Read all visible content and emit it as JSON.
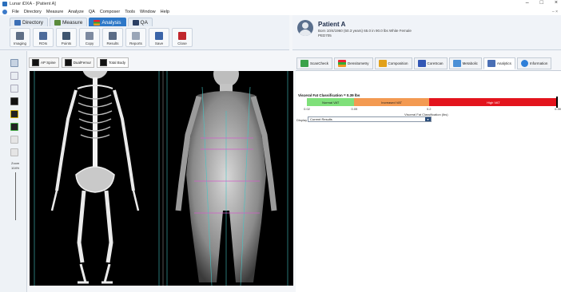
{
  "window": {
    "title": "Lunar iDXA - [Patient A]",
    "minimize": "–",
    "maximize": "□",
    "close": "×"
  },
  "menu": [
    "File",
    "Directory",
    "Measure",
    "Analyze",
    "QA",
    "Composer",
    "Tools",
    "Window",
    "Help"
  ],
  "menu_mdi": "– ×",
  "ribbon": {
    "tabs": [
      {
        "label": "Directory",
        "active": false
      },
      {
        "label": "Measure",
        "active": false
      },
      {
        "label": "Analysis",
        "active": true
      },
      {
        "label": "QA",
        "active": false
      }
    ],
    "buttons": [
      "Imaging",
      "ROIs",
      "Points",
      "Copy",
      "Results",
      "Reports",
      "Save",
      "Close"
    ]
  },
  "patient": {
    "name": "Patient A",
    "details": "Born 10/4/1960 (50.3 years)   65.0 in  90.0 lbs    White Female",
    "id": "PED705"
  },
  "zoom": {
    "label": "Zoom",
    "value": "104%"
  },
  "view_tabs": [
    "AP Spine",
    "DualFemur",
    "Total Body"
  ],
  "analysis_tabs": [
    {
      "label": "ScanCheck",
      "color": "#3aa24a",
      "active": false
    },
    {
      "label": "Densitometry",
      "color": "#e2a11a",
      "active": false
    },
    {
      "label": "Composition",
      "color": "#e2a11a",
      "active": false
    },
    {
      "label": "CoreScan",
      "color": "#3357b5",
      "active": false
    },
    {
      "label": "Metabolic",
      "color": "#4a8fd6",
      "active": false
    },
    {
      "label": "Analytics",
      "color": "#4a6fb5",
      "active": true
    },
    {
      "label": "Information",
      "color": "#2f7fd8",
      "active": false
    }
  ],
  "visceral_fat": {
    "title": "Visceral Fat Classification = 0.39 lbs",
    "value": 0.39,
    "segments": [
      {
        "label": "Normal VAT",
        "color": "#7fe07a",
        "from": 0.02,
        "to": 0.09
      },
      {
        "label": "Increased VAT",
        "color": "#f39a52",
        "from": 0.09,
        "to": 0.2
      },
      {
        "label": "High VAT",
        "color": "#e3141d",
        "from": 0.2,
        "to": 0.39
      }
    ],
    "ticks": [
      "0.02",
      "0.09",
      "0.2",
      "0.39"
    ],
    "axis_label": "Visceral Fat Classification (lbs)"
  },
  "display": {
    "label": "Display",
    "value": "Current Results"
  }
}
